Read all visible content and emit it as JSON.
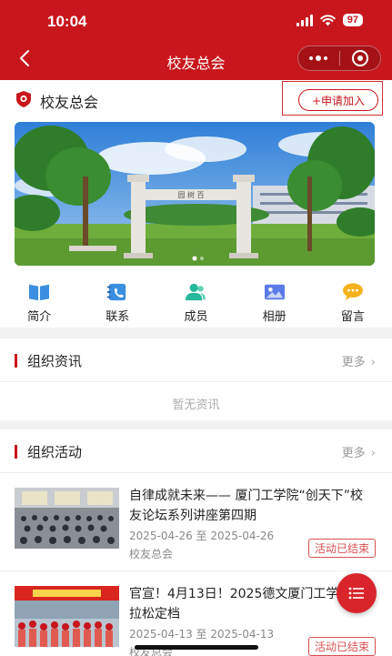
{
  "status_bar": {
    "time": "10:04",
    "battery": "97"
  },
  "nav": {
    "title": "校友总会"
  },
  "association": {
    "name": "校友总会",
    "join_label": "+申请加入"
  },
  "banner": {
    "gate_text": "园 树 百"
  },
  "quick_links": [
    {
      "label": "简介",
      "icon": "book-icon",
      "color": "#3b8fe0"
    },
    {
      "label": "联系",
      "icon": "contact-book-icon",
      "color": "#3b8fe0"
    },
    {
      "label": "成员",
      "icon": "members-icon",
      "color": "#27b89c"
    },
    {
      "label": "相册",
      "icon": "album-icon",
      "color": "#5b7be8"
    },
    {
      "label": "留言",
      "icon": "message-icon",
      "color": "#f6b21c"
    }
  ],
  "news_section": {
    "title": "组织资讯",
    "more_label": "更多",
    "empty_text": "暂无资讯"
  },
  "activity_section": {
    "title": "组织活动",
    "more_label": "更多",
    "items": [
      {
        "title": "自律成就未来—— 厦门工学院“创天下”校友论坛系列讲座第四期",
        "date": "2025-04-26 至 2025-04-26",
        "org": "校友总会",
        "status": "活动已结束"
      },
      {
        "title": "官宣！4月13日！2025德文厦门工学院马拉松定档",
        "date": "2025-04-13 至 2025-04-13",
        "org": "校友总会",
        "status": "活动已结束"
      }
    ]
  },
  "colors": {
    "brand": "#c8161d",
    "status_red": "#d85050"
  }
}
